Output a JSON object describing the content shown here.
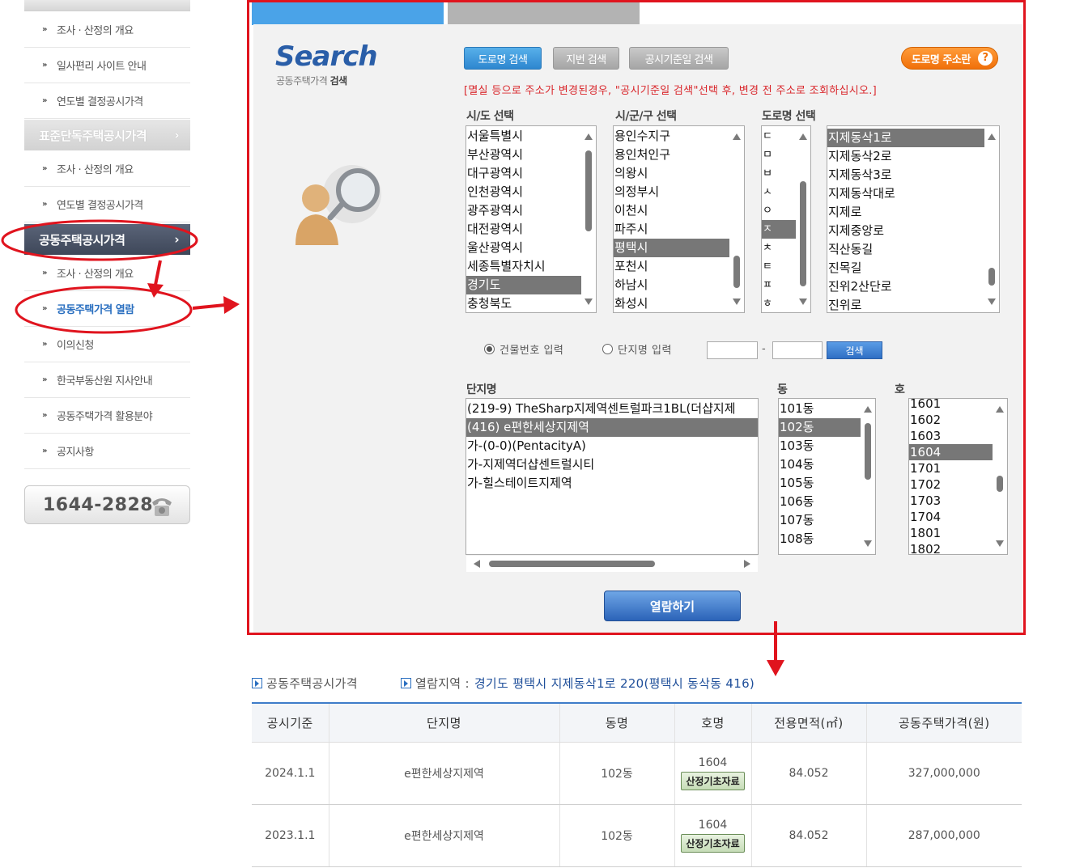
{
  "sidebar": {
    "items_group1": [
      "조사 · 산정의 개요",
      "일사편리 사이트 안내",
      "연도별 결정공시가격"
    ],
    "header_detached": "표준단독주택공시가격",
    "items_group2": [
      "조사 · 산정의 개요",
      "연도별 결정공시가격"
    ],
    "header_apartment": "공동주택공시가격",
    "items_group3": [
      "조사 · 산정의 개요",
      "공동주택가격 열람",
      "이의신청",
      "한국부동산원 지사안내",
      "공동주택가격 활용분야",
      "공지사항"
    ],
    "phone": "1644-2828"
  },
  "search": {
    "logo": "Search",
    "subtitle_prefix": "공동주택가격",
    "subtitle_bold": "검색",
    "tabs": [
      "도로명 검색",
      "지번 검색",
      "공시기준일 검색"
    ],
    "help_button": "도로명 주소란",
    "notice": "[멸실 등으로 주소가 변경된경우, \"공시기준일 검색\"선택 후, 변경 전 주소로 조회하십시오.]",
    "labels": {
      "sido": "시/도 선택",
      "sigungu": "시/군/구 선택",
      "road": "도로명 선택",
      "complex": "단지명",
      "dong": "동",
      "ho": "호"
    },
    "sido_options": [
      "서울특별시",
      "부산광역시",
      "대구광역시",
      "인천광역시",
      "광주광역시",
      "대전광역시",
      "울산광역시",
      "세종특별자치시",
      "경기도",
      "충청북도"
    ],
    "sido_selected": "경기도",
    "sigungu_options": [
      "용인수지구",
      "용인처인구",
      "의왕시",
      "의정부시",
      "이천시",
      "파주시",
      "평택시",
      "포천시",
      "하남시",
      "화성시"
    ],
    "sigungu_selected": "평택시",
    "initial_options": [
      "ㄷ",
      "ㅁ",
      "ㅂ",
      "ㅅ",
      "ㅇ",
      "ㅈ",
      "ㅊ",
      "ㅌ",
      "ㅍ",
      "ㅎ"
    ],
    "initial_selected": "ㅈ",
    "road_options": [
      "지제동삭1로",
      "지제동삭2로",
      "지제동삭3로",
      "지제동삭대로",
      "지제로",
      "지제중앙로",
      "직산동길",
      "진목길",
      "진위2산단로",
      "진위로"
    ],
    "road_selected": "지제동삭1로",
    "radio_building": "건물번호 입력",
    "radio_complex": "단지명 입력",
    "search_button": "검색",
    "complex_options": [
      "(219-9) TheSharp지제역센트럴파크1BL(더샵지제",
      "(416) e편한세상지제역",
      "가-(0-0)(PentacityA)",
      "가-지제역더샵센트럴시티",
      "가-힐스테이트지제역"
    ],
    "complex_selected": "(416) e편한세상지제역",
    "dong_options": [
      "101동",
      "102동",
      "103동",
      "104동",
      "105동",
      "106동",
      "107동",
      "108동"
    ],
    "dong_selected": "102동",
    "ho_options": [
      "1601",
      "1602",
      "1603",
      "1604",
      "1701",
      "1702",
      "1703",
      "1704",
      "1801",
      "1802"
    ],
    "ho_selected": "1604",
    "view_button": "열람하기"
  },
  "result": {
    "crumb_title": "공동주택공시가격",
    "crumb_region_label": "열람지역 :",
    "crumb_region_value": "경기도 평택시 지제동삭1로 220(평택시 동삭동 416)",
    "columns": [
      "공시기준",
      "단지명",
      "동명",
      "호명",
      "전용면적(㎡)",
      "공동주택가격(원)"
    ],
    "rows": [
      {
        "date": "2024.1.1",
        "complex": "e편한세상지제역",
        "dong": "102동",
        "ho": "1604",
        "button": "산정기초자료",
        "area": "84.052",
        "price": "327,000,000"
      },
      {
        "date": "2023.1.1",
        "complex": "e편한세상지제역",
        "dong": "102동",
        "ho": "1604",
        "button": "산정기초자료",
        "area": "84.052",
        "price": "287,000,000"
      }
    ]
  },
  "colors": {
    "annotation_red": "#e0141e",
    "accent_blue": "#2a6fc0",
    "selected_grey": "#777777"
  }
}
